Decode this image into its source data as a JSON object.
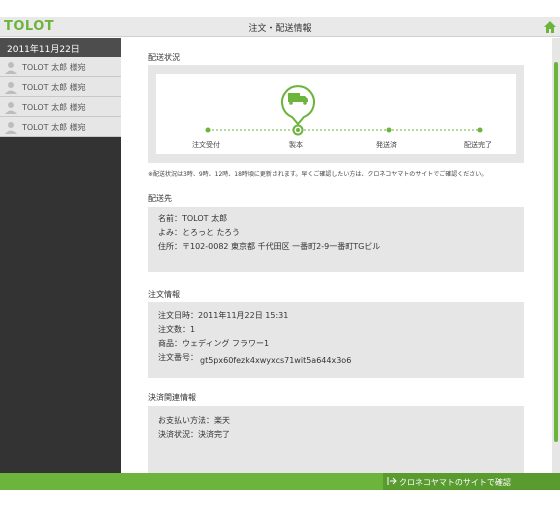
{
  "header": {
    "logo": "TOLOT",
    "title": "注文・配送情報",
    "home_icon": "home-icon"
  },
  "sidebar": {
    "date": "2011年11月22日",
    "items": [
      {
        "label": "TOLOT 太郎 様宛"
      },
      {
        "label": "TOLOT 太郎 様宛"
      },
      {
        "label": "TOLOT 太郎 様宛"
      },
      {
        "label": "TOLOT 太郎 様宛"
      }
    ]
  },
  "shipping_status": {
    "title": "配送状況",
    "steps": [
      {
        "label": "注文受付"
      },
      {
        "label": "製本"
      },
      {
        "label": "発送済"
      },
      {
        "label": "配送完了"
      }
    ],
    "current_step": 1,
    "note": "※配送状況は3時、9時、12時、18時頃に更新されます。早くご確認したい方は、クロネコヤマトのサイトでご確認ください。"
  },
  "destination": {
    "title": "配送先",
    "name": "名前：TOLOT 太郎",
    "yomi": "よみ：とろっと たろう",
    "address": "住所：〒102-0082 東京都 千代田区 一番町2-9一番町TGビル"
  },
  "order_info": {
    "title": "注文情報",
    "datetime": "注文日時：2011年11月22日 15:31",
    "count": "注文数：1",
    "product": "商品：ウェディング フラワー1",
    "number_label": "注文番号：",
    "number_value": "gt5px60fezk4xwyxcs71wit5a644x3o6"
  },
  "payment": {
    "title": "決済関連情報",
    "method": "お支払い方法：楽天",
    "status": "決済状況：決済完了"
  },
  "footer": {
    "yamato_button": "クロネコヤマトのサイトで確認"
  },
  "colors": {
    "accent": "#6cb43c",
    "sidebar_bg": "#333333",
    "panel_bg": "#e6e6e6"
  }
}
